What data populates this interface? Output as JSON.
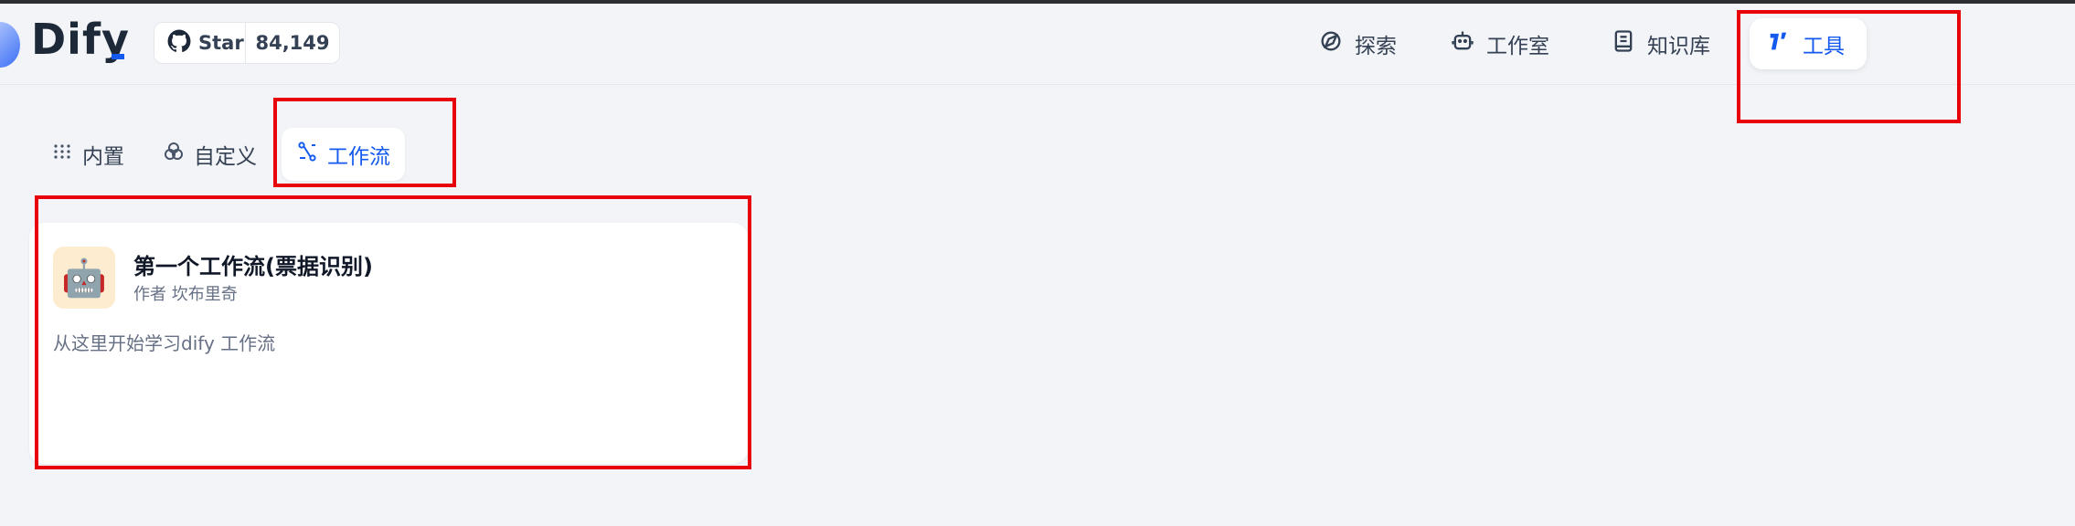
{
  "header": {
    "logo_text": "Dify",
    "github": {
      "star_label": "Star",
      "count": "84,149"
    },
    "nav": [
      {
        "label": "探索",
        "icon": "compass-icon",
        "active": false
      },
      {
        "label": "工作室",
        "icon": "robot-icon",
        "active": false
      },
      {
        "label": "知识库",
        "icon": "book-icon",
        "active": false
      },
      {
        "label": "工具",
        "icon": "tools-icon",
        "active": true
      }
    ]
  },
  "tabs": [
    {
      "label": "内置",
      "icon": "grid-dots-icon",
      "active": false
    },
    {
      "label": "自定义",
      "icon": "circles-icon",
      "active": false
    },
    {
      "label": "工作流",
      "icon": "workflow-icon",
      "active": true
    }
  ],
  "tool_card": {
    "icon": "robot-emoji-icon",
    "icon_glyph": "🤖",
    "title": "第一个工作流(票据识别)",
    "author": "作者 坎布里奇",
    "description": "从这里开始学习dify 工作流"
  },
  "colors": {
    "accent": "#155aef",
    "highlight_box": "#e8000b",
    "background": "#f2f4f7"
  }
}
